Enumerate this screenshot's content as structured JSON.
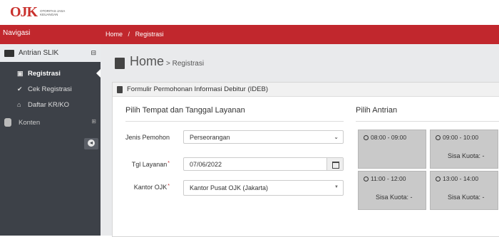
{
  "header": {
    "logo_mark": "OJK",
    "logo_text": "Otoritas Jasa Keuangan"
  },
  "nav_title": "Navigasi",
  "breadcrumb": [
    "Home",
    "/",
    "Registrasi"
  ],
  "sidebar": {
    "section": "Antrian SLIK",
    "items": [
      {
        "label": "Registrasi",
        "icon": "id-card-icon",
        "active": true
      },
      {
        "label": "Cek Registrasi",
        "icon": "check-icon",
        "active": false
      },
      {
        "label": "Daftar KR/KO",
        "icon": "bank-icon",
        "active": false
      }
    ],
    "konten": "Konten"
  },
  "page": {
    "title": "Home",
    "subtitle": "> Registrasi"
  },
  "panel": {
    "title": "Formulir Permohonan Informasi Debitur (IDEB)",
    "left_section": "Pilih Tempat dan Tanggal Layanan",
    "right_section": "Pilih Antrian",
    "fields": {
      "jenis_label": "Jenis Pemohon",
      "jenis_value": "Perseorangan",
      "tgl_label": "Tgl Layanan",
      "tgl_value": "07/06/2022",
      "kantor_label": "Kantor OJK",
      "kantor_value": "Kantor Pusat OJK (Jakarta)"
    },
    "slots": [
      {
        "time": "08:00 - 09:00",
        "kuota": ""
      },
      {
        "time": "09:00 - 10:00",
        "kuota": "Sisa Kuota: -"
      },
      {
        "time": "11:00 - 12:00",
        "kuota": "Sisa Kuota: -"
      },
      {
        "time": "13:00 - 14:00",
        "kuota": "Sisa Kuota: -"
      }
    ]
  },
  "colors": {
    "brand_red": "#c1272d",
    "sidebar_bg": "#3d4148"
  }
}
